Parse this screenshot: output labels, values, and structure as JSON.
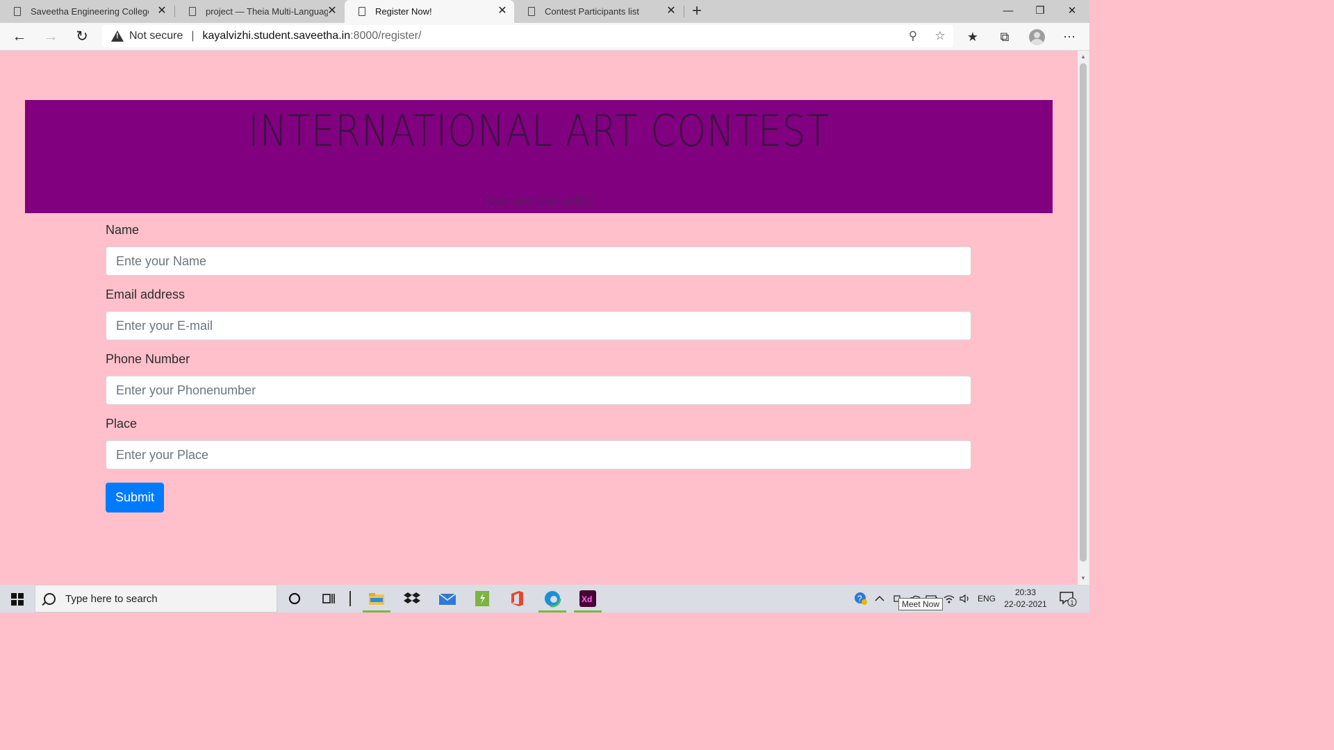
{
  "browser": {
    "tabs": [
      {
        "title": "Saveetha Engineering College",
        "active": false
      },
      {
        "title": "project — Theia Multi-Language",
        "active": false
      },
      {
        "title": "Register Now!",
        "active": true
      },
      {
        "title": "Contest Participants list",
        "active": false
      }
    ],
    "new_tab_glyph": "+",
    "security_label": "Not secure",
    "url_host": "kayalvizhi.student.saveetha.in",
    "url_rest": ":8000/register/"
  },
  "page": {
    "heading": "INTERNATIONAL ART CONTEST",
    "tagline": "You are the artist",
    "colors": {
      "background": "#ffc0cb",
      "banner": "#800080",
      "button": "#007bff"
    },
    "form": {
      "name_label": "Name",
      "name_placeholder": "Ente your Name",
      "email_label": "Email address",
      "email_placeholder": "Enter your E-mail",
      "phone_label": "Phone Number",
      "phone_placeholder": "Enter your Phonenumber",
      "place_label": "Place",
      "place_placeholder": "Enter your Place",
      "submit_label": "Submit"
    }
  },
  "taskbar": {
    "search_placeholder": "Type here to search",
    "language": "ENG",
    "time": "20:33",
    "date": "22-02-2021",
    "notification_count": "1",
    "tooltip": "Meet Now",
    "apps": [
      "cortana-icon",
      "task-view-icon",
      "file-explorer-icon",
      "dropbox-icon",
      "mail-icon",
      "sublime-icon",
      "office-icon",
      "edge-icon",
      "adobe-xd-icon"
    ]
  }
}
